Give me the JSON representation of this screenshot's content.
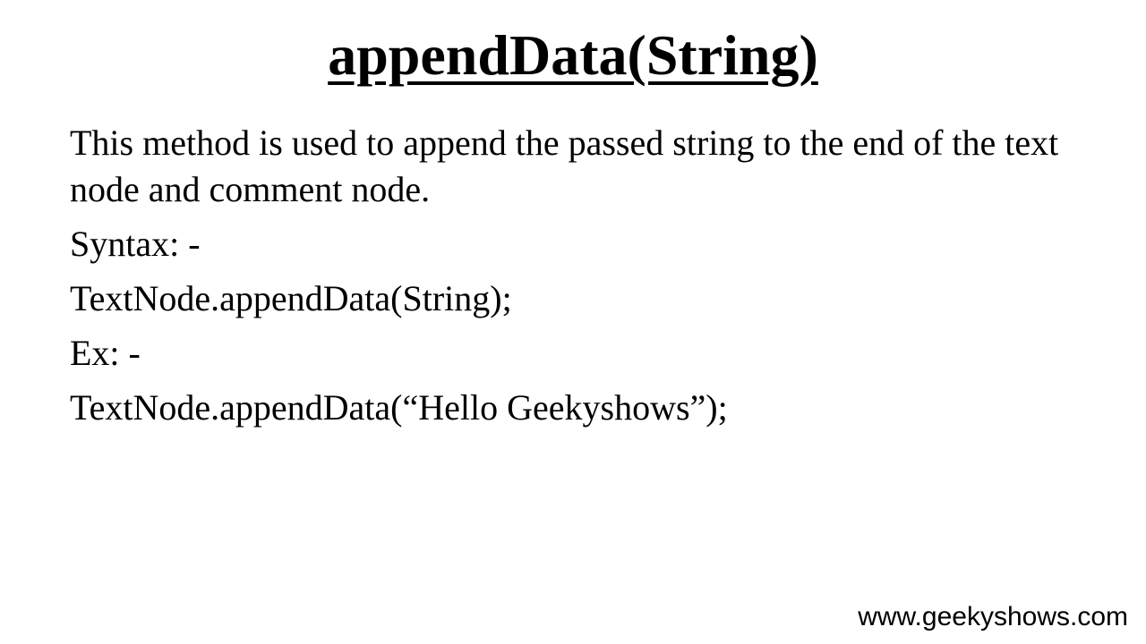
{
  "slide": {
    "title": "appendData(String)",
    "description": "This method is used to append the passed string to the end of the text node and comment node.",
    "syntax_label": "Syntax: -",
    "syntax": "TextNode.appendData(String);",
    "example_label": "Ex: -",
    "example": "TextNode.appendData(“Hello Geekyshows”);"
  },
  "footer": {
    "website": "www.geekyshows.com"
  }
}
